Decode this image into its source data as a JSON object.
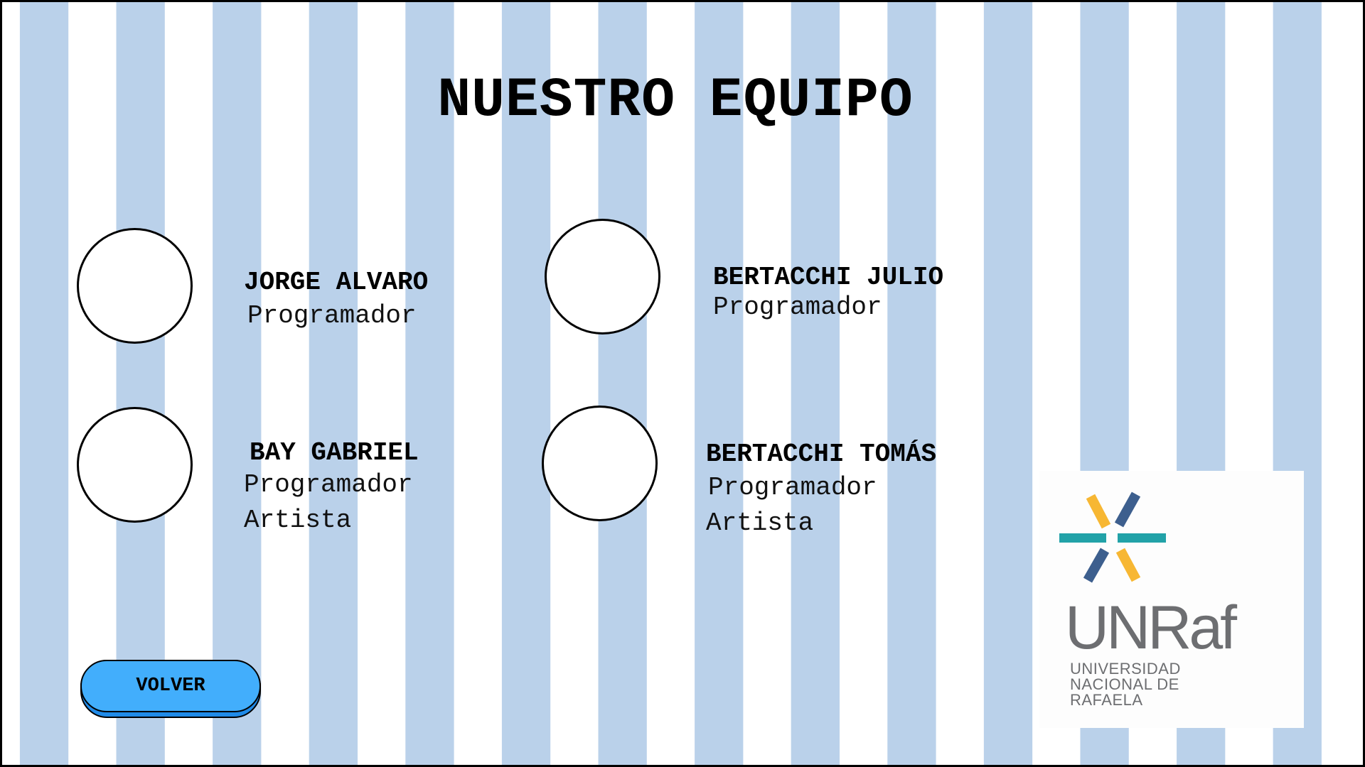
{
  "screen": {
    "title": "NUESTRO EQUIPO"
  },
  "team": [
    {
      "name": "JORGE ALVARO",
      "roles": [
        "Programador"
      ]
    },
    {
      "name": "BERTACCHI JULIO",
      "roles": [
        "Programador"
      ]
    },
    {
      "name": "BAY GABRIEL",
      "roles": [
        "Programador",
        "Artista"
      ]
    },
    {
      "name": "BERTACCHI TOMÁS",
      "roles": [
        "Programador",
        "Artista"
      ]
    }
  ],
  "back_button": {
    "label": "VOLVER"
  },
  "logo": {
    "wordmark": "UNRaf",
    "subtitle_lines": [
      "UNIVERSIDAD",
      "NACIONAL DE",
      "RAFAELA"
    ],
    "colors": {
      "yellow": "#f7b733",
      "navy": "#3d5f8e",
      "teal": "#22a2a8",
      "gray": "#6d6e71"
    }
  },
  "theme": {
    "stripe_blue": "#bad1ea",
    "stripe_white": "#ffffff",
    "button_blue": "#42aefc"
  }
}
